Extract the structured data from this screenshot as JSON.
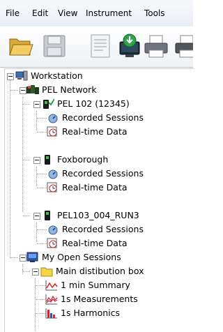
{
  "menu": [
    "File",
    "Edit",
    "View",
    "Instrument",
    "Tools"
  ],
  "toolbar": {
    "buttons": [
      "open-folder",
      "save",
      "report",
      "download",
      "computer",
      "print",
      "printer-2"
    ]
  },
  "tree": {
    "root": "Workstation",
    "network": "PEL Network",
    "pel102": "PEL 102 (12345)",
    "rec1": "Recorded Sessions",
    "rt1": "Real-time Data",
    "foxborough": "Foxborough",
    "rec2": "Recorded Sessions",
    "rt2": "Real-time Data",
    "pel103": "PEL103_004_RUN3",
    "rec3": "Recorded Sessions",
    "rt3": "Real-time Data",
    "open": "My Open Sessions",
    "box": "Main distibution box",
    "summary": "1 min Summary",
    "measurements": "1s Measurements",
    "harmonics": "1s Harmonics"
  }
}
